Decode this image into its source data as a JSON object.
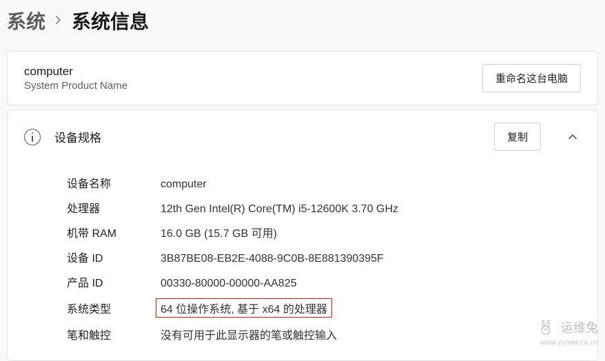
{
  "breadcrumb": {
    "parent": "系统",
    "current": "系统信息"
  },
  "header": {
    "computer_name": "computer",
    "product_name": "System Product Name",
    "rename_button": "重命名这台电脑"
  },
  "specs": {
    "title": "设备规格",
    "copy_button": "复制",
    "rows": [
      {
        "label": "设备名称",
        "value": "computer"
      },
      {
        "label": "处理器",
        "value": "12th Gen Intel(R) Core(TM) i5-12600K   3.70 GHz"
      },
      {
        "label": "机带 RAM",
        "value": "16.0 GB (15.7 GB 可用)"
      },
      {
        "label": "设备 ID",
        "value": "3B87BE08-EB2E-4088-9C0B-8E881390395F"
      },
      {
        "label": "产品 ID",
        "value": "00330-80000-00000-AA825"
      },
      {
        "label": "系统类型",
        "value": "64 位操作系统, 基于 x64 的处理器",
        "highlight": true
      },
      {
        "label": "笔和触控",
        "value": "没有可用于此显示器的笔或触控输入"
      }
    ]
  },
  "watermark": {
    "text": "运维兔",
    "url": "www.yunweitu.cn"
  }
}
